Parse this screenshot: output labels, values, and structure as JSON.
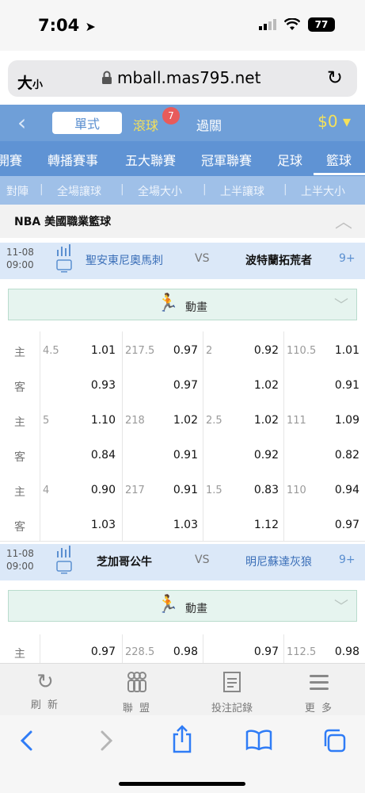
{
  "status": {
    "time": "7:04",
    "battery": "77"
  },
  "browser": {
    "text_size": "大",
    "text_size_small": "小",
    "url": "mball.mas795.net"
  },
  "nav": {
    "tab_single": "單式",
    "tab_live": "滾球",
    "live_badge": "7",
    "tab_parlay": "過關",
    "balance": "$0 ▾"
  },
  "categories": [
    "開賽",
    "轉播賽事",
    "五大聯賽",
    "冠軍聯賽",
    "足球",
    "籃球"
  ],
  "subtabs": [
    "對陣",
    "全場讓球",
    "全場大小",
    "上半讓球",
    "上半大小"
  ],
  "league": "NBA 美國職業籃球",
  "matches": [
    {
      "date": "11-08",
      "time": "09:00",
      "home": "聖安東尼奧馬刺",
      "vs": "VS",
      "away": "波特蘭拓荒者",
      "more": "9+"
    },
    {
      "date": "11-08",
      "time": "09:00",
      "home": "芝加哥公牛",
      "vs": "VS",
      "away": "明尼蘇達灰狼",
      "more": "9+"
    }
  ],
  "animation_label": "動畫",
  "side_home": "主",
  "side_away": "客",
  "odds": [
    {
      "h1": "4.5",
      "o1": "1.01",
      "h2": "217.5",
      "o2": "0.97",
      "h3": "2",
      "o3": "0.92",
      "h4": "110.5",
      "o4": "1.01",
      "a1": "0.93",
      "a2": "0.97",
      "a3": "1.02",
      "a4": "0.91"
    },
    {
      "h1": "5",
      "o1": "1.10",
      "h2": "218",
      "o2": "1.02",
      "h3": "2.5",
      "o3": "1.02",
      "h4": "111",
      "o4": "1.09",
      "a1": "0.84",
      "a2": "0.91",
      "a3": "0.92",
      "a4": "0.82"
    },
    {
      "h1": "4",
      "o1": "0.90",
      "h2": "217",
      "o2": "0.91",
      "h3": "1.5",
      "o3": "0.83",
      "h4": "110",
      "o4": "0.94",
      "a1": "1.03",
      "a2": "1.03",
      "a3": "1.12",
      "a4": "0.97"
    }
  ],
  "odds2": {
    "o1": "0.97",
    "h2": "228.5",
    "o2": "0.98",
    "o3": "0.97",
    "h4": "112.5",
    "o4": "0.98"
  },
  "toolbar": {
    "refresh": "刷 新",
    "league": "聯 盟",
    "bets": "投注記錄",
    "more": "更 多"
  }
}
